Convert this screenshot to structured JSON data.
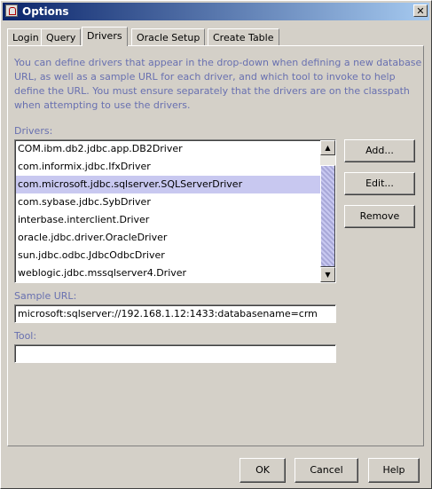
{
  "window": {
    "title": "Options",
    "close_glyph": "✕"
  },
  "tabs": [
    "Login",
    "Query",
    "Drivers",
    "Oracle Setup",
    "Create Table"
  ],
  "active_tab": "Drivers",
  "description": "You can define drivers that appear in the drop-down when defining a new database URL, as well as a sample URL for each driver, and which tool to invoke to help define the URL.  You must ensure separately that the drivers are on the classpath when attempting to use the drivers.",
  "drivers": {
    "label": "Drivers:",
    "items": [
      "COM.ibm.db2.jdbc.app.DB2Driver",
      "com.informix.jdbc.IfxDriver",
      "com.microsoft.jdbc.sqlserver.SQLServerDriver",
      "com.sybase.jdbc.SybDriver",
      "interbase.interclient.Driver",
      "oracle.jdbc.driver.OracleDriver",
      "sun.jdbc.odbc.JdbcOdbcDriver",
      "weblogic.jdbc.mssqlserver4.Driver"
    ],
    "selected_index": 2,
    "add_label": "Add...",
    "edit_label": "Edit...",
    "remove_label": "Remove"
  },
  "sample_url": {
    "label": "Sample URL:",
    "value": "microsoft:sqlserver://192.168.1.12:1433:databasename=crm"
  },
  "tool": {
    "label": "Tool:",
    "value": ""
  },
  "footer": {
    "ok_label": "OK",
    "cancel_label": "Cancel",
    "help_label": "Help"
  },
  "colors": {
    "title_start": "#0a246a",
    "title_end": "#a6caf0",
    "label_text": "#6870b0",
    "selection": "#c8c8f0",
    "dialog_bg": "#d4d0c8"
  },
  "icons": {
    "scroll_up": "▲",
    "scroll_down": "▼"
  }
}
